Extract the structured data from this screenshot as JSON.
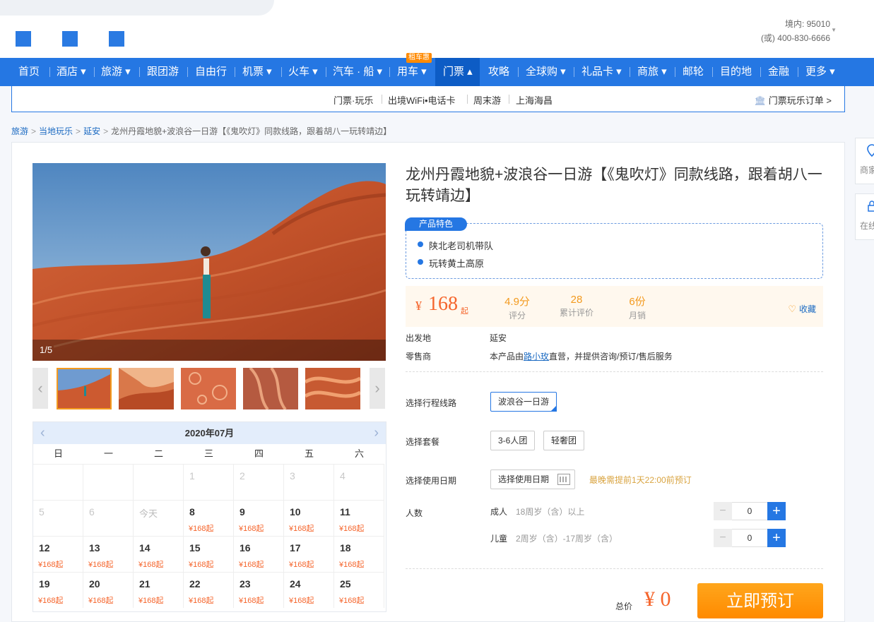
{
  "header": {
    "hotline_domestic": "境内: 95010",
    "hotline_other": "(或) 400-830-6666"
  },
  "nav": {
    "items": [
      {
        "label": "首页"
      },
      {
        "label": "酒店 ▾"
      },
      {
        "label": "旅游 ▾"
      },
      {
        "label": "跟团游"
      },
      {
        "label": "自由行"
      },
      {
        "label": "机票 ▾"
      },
      {
        "label": "火车 ▾"
      },
      {
        "label": "汽车 · 船 ▾"
      },
      {
        "label": "用车 ▾"
      },
      {
        "label": "门票 ▴"
      },
      {
        "label": "攻略"
      },
      {
        "label": "全球购 ▾"
      },
      {
        "label": "礼品卡 ▾"
      },
      {
        "label": "商旅 ▾"
      },
      {
        "label": "邮轮"
      },
      {
        "label": "目的地"
      },
      {
        "label": "金融"
      },
      {
        "label": "更多 ▾"
      }
    ],
    "badge": "租车惠"
  },
  "subnav": {
    "items": [
      "门票·玩乐",
      "出境WiFi•电话卡",
      "周末游",
      "上海海昌"
    ],
    "order_link": "门票玩乐订单 >"
  },
  "breadcrumb": {
    "items": [
      "旅游",
      "当地玩乐",
      "延安"
    ],
    "current": "龙州丹霞地貌+波浪谷一日游【《鬼吹灯》同款线路，跟着胡八一玩转靖边】"
  },
  "side": {
    "widget1": "商家",
    "widget2": "在线"
  },
  "gallery": {
    "counter": "1/5"
  },
  "calendar": {
    "month": "2020年07月",
    "dow": [
      "日",
      "一",
      "二",
      "三",
      "四",
      "五",
      "六"
    ],
    "weeks": [
      [
        {
          "d": ""
        },
        {
          "d": ""
        },
        {
          "d": ""
        },
        {
          "d": "1",
          "dim": true
        },
        {
          "d": "2",
          "dim": true
        },
        {
          "d": "3",
          "dim": true
        },
        {
          "d": "4",
          "dim": true
        }
      ],
      [
        {
          "d": "5",
          "dim": true
        },
        {
          "d": "6",
          "dim": true
        },
        {
          "d": "今天",
          "today": true
        },
        {
          "d": "8",
          "p": "¥168起"
        },
        {
          "d": "9",
          "p": "¥168起"
        },
        {
          "d": "10",
          "p": "¥168起"
        },
        {
          "d": "11",
          "p": "¥168起"
        }
      ],
      [
        {
          "d": "12",
          "p": "¥168起"
        },
        {
          "d": "13",
          "p": "¥168起"
        },
        {
          "d": "14",
          "p": "¥168起"
        },
        {
          "d": "15",
          "p": "¥168起"
        },
        {
          "d": "16",
          "p": "¥168起"
        },
        {
          "d": "17",
          "p": "¥168起"
        },
        {
          "d": "18",
          "p": "¥168起"
        }
      ],
      [
        {
          "d": "19",
          "p": "¥168起"
        },
        {
          "d": "20",
          "p": "¥168起"
        },
        {
          "d": "21",
          "p": "¥168起"
        },
        {
          "d": "22",
          "p": "¥168起"
        },
        {
          "d": "23",
          "p": "¥168起"
        },
        {
          "d": "24",
          "p": "¥168起"
        },
        {
          "d": "25",
          "p": "¥168起"
        }
      ]
    ]
  },
  "product": {
    "title": "龙州丹霞地貌+波浪谷一日游【《鬼吹灯》同款线路，跟着胡八一玩转靖边】",
    "feature_tag": "产品特色",
    "features": [
      "陕北老司机带队",
      "玩转黄土高原"
    ],
    "price_currency": "¥",
    "price_value": "168",
    "price_suffix": "起",
    "stats": [
      {
        "value": "4.9分",
        "label": "评分"
      },
      {
        "value": "28",
        "label": "累计评价"
      },
      {
        "value": "6份",
        "label": "月销"
      }
    ],
    "fav_label": "收藏",
    "departure_label": "出发地",
    "departure_value": "延安",
    "seller_label": "零售商",
    "seller_prefix": "本产品由",
    "seller_name": "路小玫",
    "seller_suffix": "直营，并提供咨询/预订/售后服务"
  },
  "options": {
    "route_label": "选择行程线路",
    "route_selected": "波浪谷一日游",
    "package_label": "选择套餐",
    "packages": [
      "3-6人团",
      "轻奢团"
    ],
    "date_label": "选择使用日期",
    "date_placeholder": "选择使用日期",
    "date_note": "最晚需提前1天22:00前预订",
    "people_label": "人数",
    "adult_label": "成人",
    "adult_desc": "18周岁（含）以上",
    "adult_count": "0",
    "child_label": "儿童",
    "child_desc": "2周岁（含）-17周岁（含）",
    "child_count": "0"
  },
  "footer": {
    "total_label": "总价",
    "total_value": "¥ 0",
    "book_label": "立即预订"
  }
}
